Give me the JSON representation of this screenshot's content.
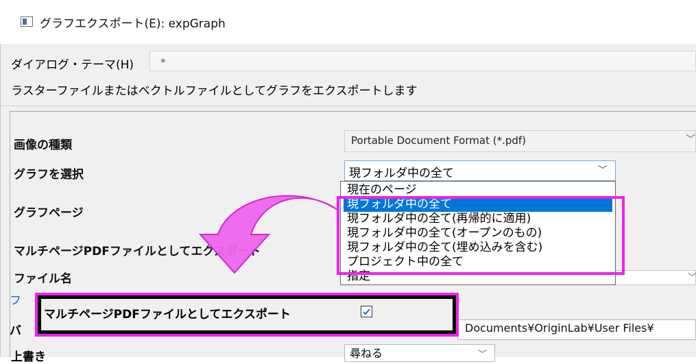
{
  "window": {
    "title": "グラフエクスポート(E): expGraph"
  },
  "theme": {
    "label": "ダイアログ・テーマ(H)",
    "value": "*"
  },
  "description": "ラスターファイルまたはベクトルファイルとしてグラフをエクスポートします",
  "fields": {
    "image_type_label": "画像の種類",
    "image_type_value": "Portable Document Format (*.pdf)",
    "select_graph_label": "グラフを選択",
    "select_graph_value": "現フォルダ中の全て",
    "graph_page_label": "グラフページ",
    "multipage_label": "マルチページPDFファイルとしてエクスポート",
    "file_name_label": "ファイル名",
    "path_value": "Documents¥OriginLab¥User Files¥",
    "overwrite_label": "上書き",
    "overwrite_value": "尋ねる"
  },
  "dropdown": {
    "options": [
      "現在のページ",
      "現フォルダ中の全て",
      "現フォルダ中の全て(再帰的に適用)",
      "現フォルダ中の全て(オープンのもの)",
      "現フォルダ中の全て(埋め込みを含む)",
      "プロジェクト中の全て",
      "指定"
    ],
    "selected_index": 1
  },
  "callout": {
    "label": "マルチページPDFファイルとしてエクスポート",
    "checked": true
  },
  "colors": {
    "highlight": "#ee22ee",
    "selection": "#0078d7"
  }
}
